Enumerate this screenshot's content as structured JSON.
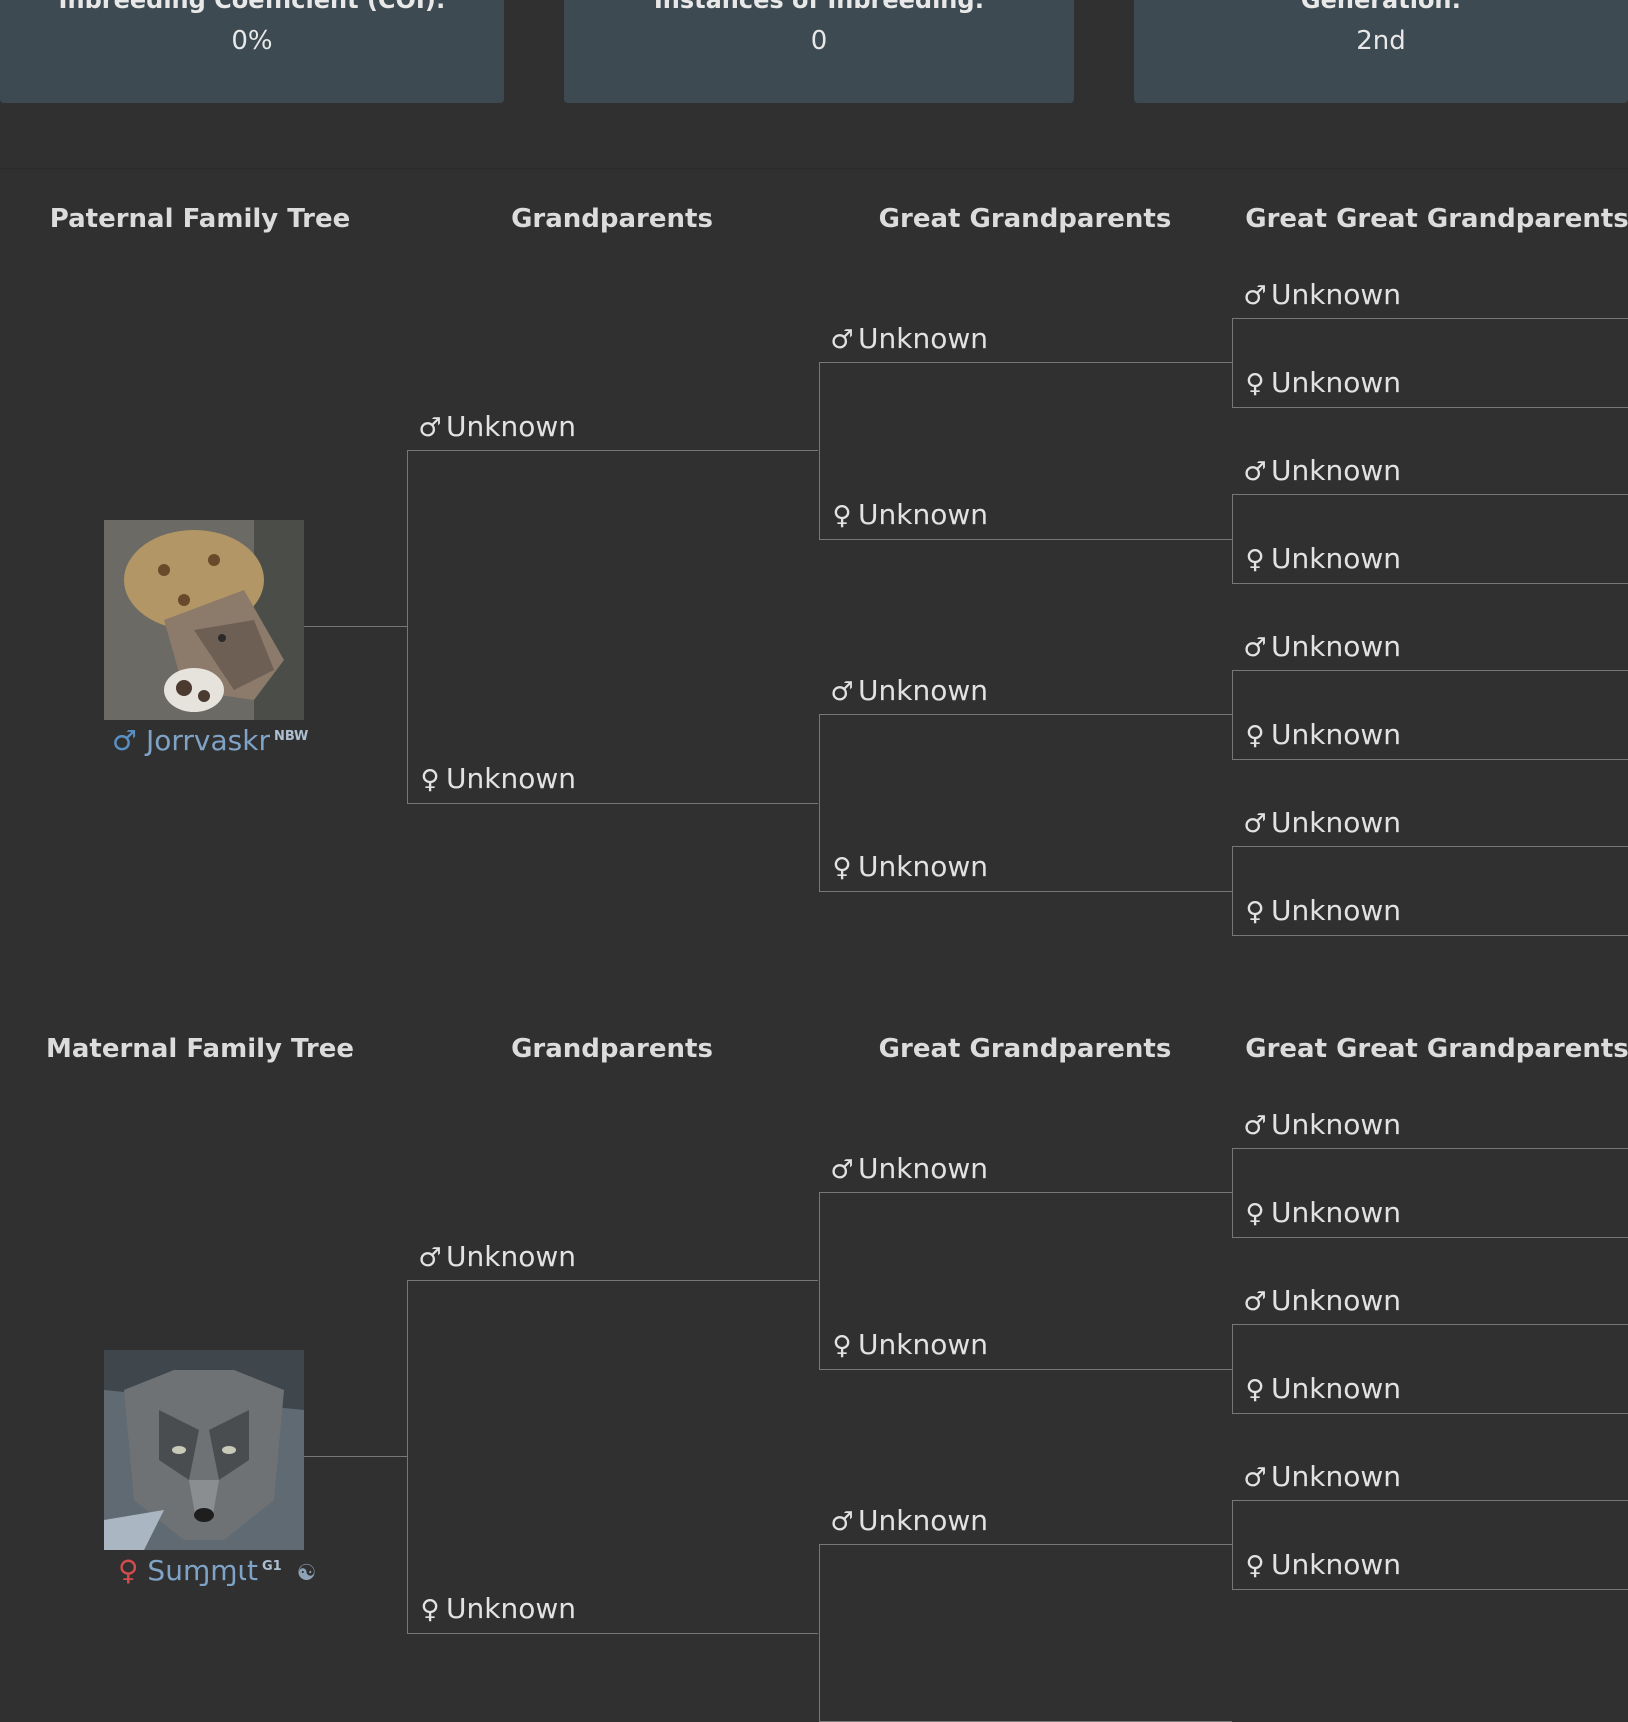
{
  "stats": [
    {
      "label": "Inbreeding Coefficient (COI):",
      "value": "0%"
    },
    {
      "label": "Instances of Inbreeding:",
      "value": "0"
    },
    {
      "label": "Generation:",
      "value": "2nd"
    }
  ],
  "columns": {
    "grandparents": "Grandparents",
    "great_grandparents": "Great Grandparents",
    "great_great_grandparents": "Great Great Grandparents"
  },
  "paternal": {
    "title": "Paternal Family Tree",
    "subject": {
      "sex_symbol": "♂",
      "name": "Jorrvaskr",
      "badge": "NBW",
      "name_color": "#7fa3c6",
      "symbol_color": "#5a8fc4"
    },
    "unknown_label": "Unknown"
  },
  "maternal": {
    "title": "Maternal Family Tree",
    "subject": {
      "sex_symbol": "♀",
      "name": "Suɱɱɩt",
      "badge": "G1",
      "name_color": "#7fa3c6",
      "symbol_color": "#d14c4c",
      "extra_icon": "yin-yang-icon",
      "extra_symbol": "☯"
    },
    "unknown_label": "Unknown"
  },
  "symbols": {
    "male": "♂",
    "female": "♀"
  }
}
